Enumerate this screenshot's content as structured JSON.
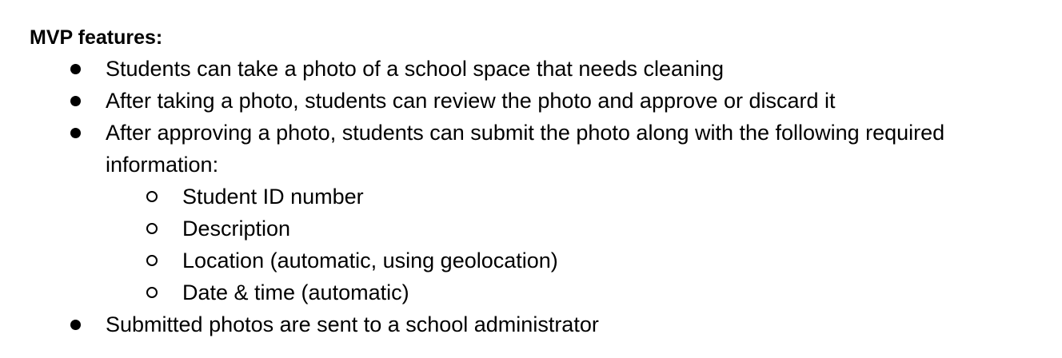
{
  "document": {
    "heading": "MVP features:",
    "items": [
      {
        "text": "Students can take a photo of a school space that needs cleaning"
      },
      {
        "text": "After taking a photo, students can review the photo and approve or discard it"
      },
      {
        "text": "After approving a photo, students can submit the photo along with the following required",
        "continuation": "information:",
        "subitems": [
          "Student ID number",
          "Description",
          "Location (automatic, using geolocation)",
          "Date & time (automatic)"
        ]
      },
      {
        "text": "Submitted photos are sent to a school administrator"
      }
    ]
  }
}
